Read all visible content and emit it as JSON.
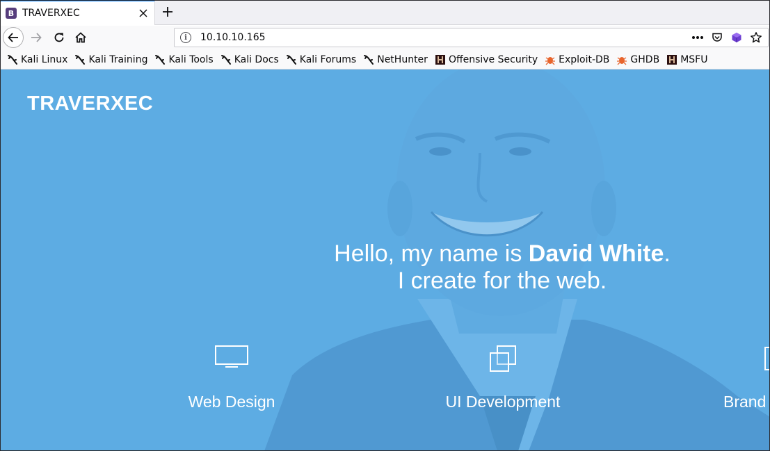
{
  "browser": {
    "tab": {
      "favicon_letter": "B",
      "title": "TRAVERXEC"
    },
    "url": "10.10.10.165",
    "icons": {
      "back": "back-arrow-icon",
      "forward": "forward-arrow-icon",
      "reload": "reload-icon",
      "home": "home-icon",
      "info": "info-icon",
      "more": "more-dots-icon",
      "pocket": "pocket-icon",
      "extension": "extension-cube-icon",
      "bookmark": "star-icon"
    },
    "bookmarks": [
      {
        "label": "Kali Linux",
        "icon": "kali-dragon-icon"
      },
      {
        "label": "Kali Training",
        "icon": "kali-dragon-icon"
      },
      {
        "label": "Kali Tools",
        "icon": "kali-dragon-icon"
      },
      {
        "label": "Kali Docs",
        "icon": "kali-dragon-icon"
      },
      {
        "label": "Kali Forums",
        "icon": "kali-dragon-icon"
      },
      {
        "label": "NetHunter",
        "icon": "kali-dragon-icon"
      },
      {
        "label": "Offensive Security",
        "icon": "offsec-icon"
      },
      {
        "label": "Exploit-DB",
        "icon": "exploitdb-bug-icon"
      },
      {
        "label": "GHDB",
        "icon": "exploitdb-bug-icon"
      },
      {
        "label": "MSFU",
        "icon": "offsec-icon"
      }
    ]
  },
  "page": {
    "brand": "TRAVERXEC",
    "hero": {
      "greeting": "Hello, my name is ",
      "name": "David White",
      "period": ".",
      "tagline": "I create for the web."
    },
    "services": [
      {
        "label": "Web Design",
        "icon": "monitor-icon"
      },
      {
        "label": "UI Development",
        "icon": "windows-stack-icon"
      },
      {
        "label": "Brand",
        "icon": "document-icon"
      }
    ],
    "colors": {
      "overlay": "#61afe8",
      "accent": "#0a84ff",
      "text": "#ffffff"
    }
  }
}
